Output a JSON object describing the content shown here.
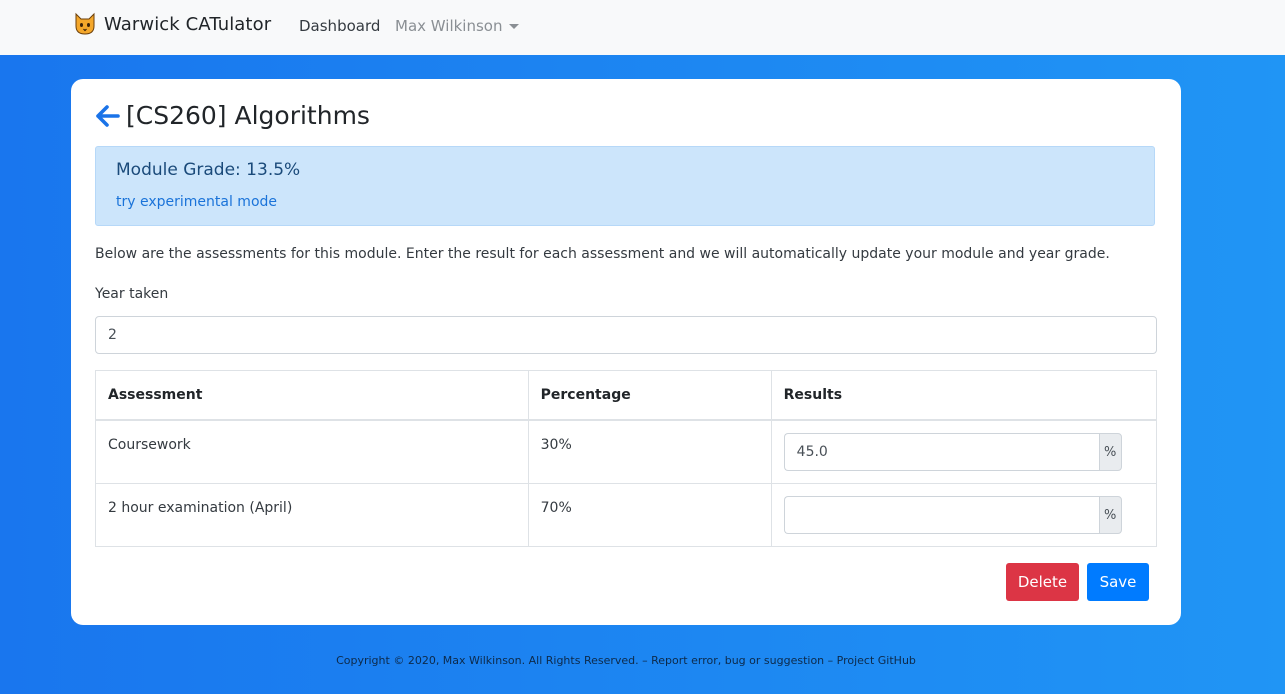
{
  "navbar": {
    "brand_icon": "cat-face-icon",
    "brand": "Warwick CATulator",
    "links": {
      "dashboard": "Dashboard",
      "user": "Max Wilkinson"
    }
  },
  "module": {
    "back_icon": "arrow-left-icon",
    "title": "[CS260] Algorithms",
    "grade_text": "Module Grade: 13.5%",
    "experimental_link": "try experimental mode",
    "intro": "Below are the assessments for this module. Enter the result for each assessment and we will automatically update your module and year grade.",
    "year_label": "Year taken",
    "year_value": "2"
  },
  "table": {
    "headers": [
      "Assessment",
      "Percentage",
      "Results"
    ],
    "rows": [
      {
        "assessment": "Coursework",
        "percentage": "30%",
        "result": "45.0",
        "suffix": "%"
      },
      {
        "assessment": "2 hour examination (April)",
        "percentage": "70%",
        "result": "",
        "suffix": "%"
      }
    ]
  },
  "actions": {
    "delete_label": "Delete",
    "save_label": "Save"
  },
  "footer": {
    "copyright": "Copyright © 2020, Max Wilkinson. All Rights Reserved.",
    "separator": " – ",
    "report_link": "Report error, bug or suggestion",
    "github_link": "Project GitHub"
  },
  "colors": {
    "primary": "#007bff",
    "danger": "#dc3545",
    "alert_bg": "#cce5fb",
    "background_gradient": [
      "#1976ee",
      "#2095f5"
    ]
  }
}
